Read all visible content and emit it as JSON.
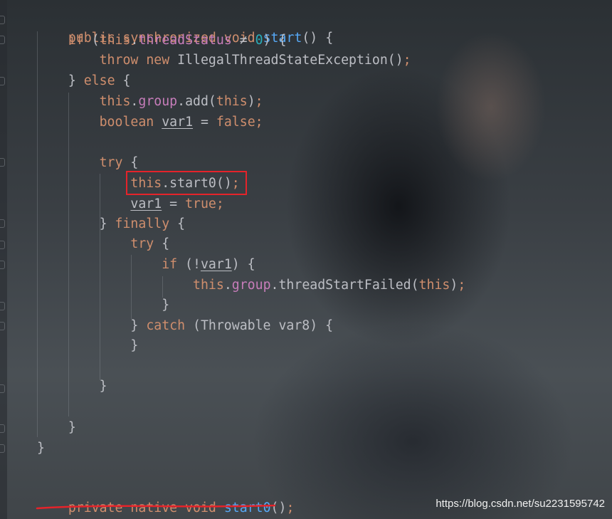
{
  "code": {
    "start_sig": {
      "kw1": "public",
      "kw2": "synchronized",
      "kw3": "void",
      "name": "start",
      "rest": "() {"
    },
    "if_line": {
      "kw": "if",
      "p1": " (",
      "this": "this",
      "dot": ".",
      "field": "threadStatus",
      "op": " ≠ ",
      "num": "0",
      "p2": ") {"
    },
    "throw_line": {
      "kw1": "throw",
      "kw2": "new",
      "rest": "IllegalThreadStateException()",
      "semi": ";"
    },
    "else_line": {
      "brace": "}",
      "kw": "else",
      "rest": " {"
    },
    "group_add_line": {
      "this1": "this",
      "dot": ".",
      "field": "group",
      "mid": ".add(",
      "this2": "this",
      "end": ")",
      "semi": ";"
    },
    "bool_line": {
      "kw": "boolean",
      "var": "var1",
      "eq": " = ",
      "val": "false",
      "semi": ";"
    },
    "try_line": {
      "kw": "try",
      "rest": " {"
    },
    "start0_line": {
      "this": "this",
      "rest": ".start0()",
      "semi": ";"
    },
    "assign_line": {
      "var": "var1",
      "eq": " = ",
      "val": "true",
      "semi": ";"
    },
    "finally_line": {
      "brace": "}",
      "kw": "finally",
      "rest": " {"
    },
    "try2_line": {
      "kw": "try",
      "rest": " {"
    },
    "if2_line": {
      "kw": "if",
      "p1": " (!",
      "var": "var1",
      "p2": ") {"
    },
    "failed_line": {
      "this1": "this",
      "dot": ".",
      "field": "group",
      "mid": ".threadStartFailed(",
      "this2": "this",
      "end": ")",
      "semi": ";"
    },
    "close1": "}",
    "catch_line": {
      "brace": "}",
      "kw": "catch",
      "rest": " (Throwable var8) {"
    },
    "close2": "}",
    "close3": "}",
    "close4": "}",
    "close5": "}",
    "native_line": {
      "kw1": "private",
      "kw2": "native",
      "kw3": "void",
      "name": "start0",
      "rest": "()",
      "semi": ";"
    }
  },
  "watermark": "https://blog.csdn.net/su2231595742",
  "colors": {
    "keyword": "#cf8e6d",
    "method": "#56a8f5",
    "field": "#c77dba",
    "number": "#2aacb8",
    "plain": "#bcbec4",
    "highlight": "#e5232a"
  }
}
